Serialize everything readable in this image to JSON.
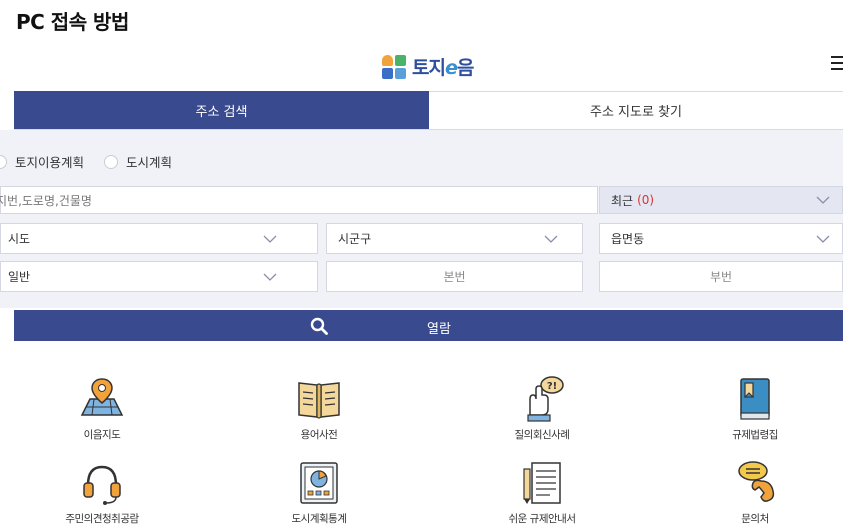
{
  "page": {
    "heading": "PC 접속 방법"
  },
  "header": {
    "logo_text_1": "토지",
    "logo_text_e": "e",
    "logo_text_2": "음",
    "menu_icon": "hamburger-icon"
  },
  "tabs": [
    {
      "label": "주소 검색",
      "active": true
    },
    {
      "label": "주소 지도로 찾기",
      "active": false
    }
  ],
  "radios": [
    {
      "label": "토지이용계획"
    },
    {
      "label": "도시계획"
    }
  ],
  "search": {
    "placeholder": "지번,도로명,건물명",
    "recent_label": "최근",
    "recent_count": "(0)"
  },
  "selects": {
    "sido": "시도",
    "sigungu": "시군구",
    "eupmyeondong": "읍면동",
    "ilban": "일반",
    "bonbeon": "본번",
    "bubeon": "부번"
  },
  "view_button": {
    "label": "열람",
    "icon": "search-icon"
  },
  "quick_links": [
    {
      "label": "이음지도",
      "icon": "map-pin-icon"
    },
    {
      "label": "용어사전",
      "icon": "book-icon"
    },
    {
      "label": "질의회신사례",
      "icon": "hand-question-icon"
    },
    {
      "label": "규제법령집",
      "icon": "law-book-icon"
    },
    {
      "label": "주민의견청취공람",
      "icon": "headset-icon"
    },
    {
      "label": "도시계획통계",
      "icon": "chart-board-icon"
    },
    {
      "label": "쉬운 규제안내서",
      "icon": "document-icon"
    },
    {
      "label": "문의처",
      "icon": "phone-chat-icon"
    }
  ],
  "colors": {
    "primary": "#3a4a8e",
    "panel": "#f1f2f8",
    "accent_red": "#d33333"
  }
}
